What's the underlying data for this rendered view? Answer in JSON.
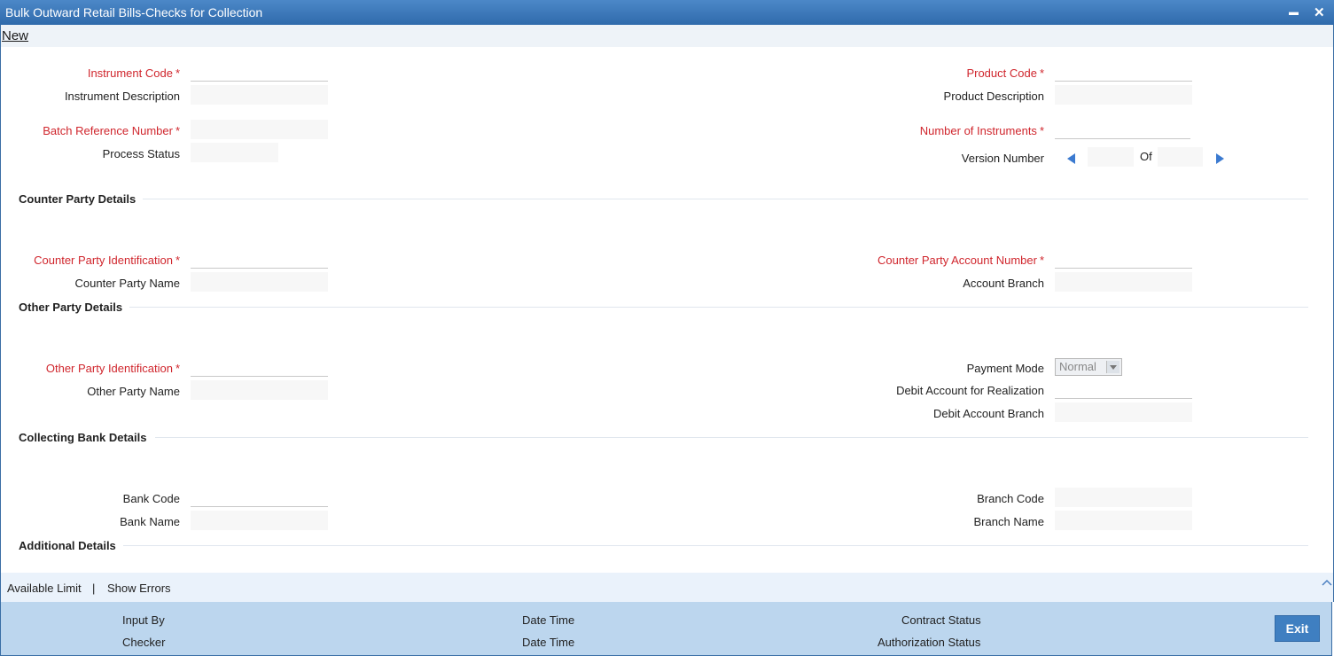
{
  "window": {
    "title": "Bulk Outward Retail Bills-Checks for Collection",
    "minimize": "▬",
    "close": "✕"
  },
  "menu": {
    "new": "New"
  },
  "main": {
    "instrument_code": "Instrument Code",
    "instrument_description": "Instrument Description",
    "batch_reference_number": "Batch Reference Number",
    "process_status": "Process Status",
    "product_code": "Product Code",
    "product_description": "Product Description",
    "number_of_instruments": "Number of Instruments",
    "version_number": "Version Number",
    "of": "Of",
    "required_marker": "*"
  },
  "counter_party": {
    "heading": "Counter Party Details",
    "identification": "Counter Party Identification",
    "name": "Counter Party Name",
    "account_number": "Counter Party Account Number",
    "account_branch": "Account Branch"
  },
  "other_party": {
    "heading": "Other Party Details",
    "identification": "Other Party Identification",
    "name": "Other Party Name",
    "payment_mode": "Payment Mode",
    "payment_mode_value": "Normal",
    "debit_account": "Debit Account for Realization",
    "debit_account_branch": "Debit Account Branch"
  },
  "collecting_bank": {
    "heading": "Collecting Bank Details",
    "bank_code": "Bank Code",
    "bank_name": "Bank Name",
    "branch_code": "Branch Code",
    "branch_name": "Branch Name"
  },
  "additional": {
    "heading": "Additional Details"
  },
  "links": {
    "available_limit": "Available Limit",
    "separator": "|",
    "show_errors": "Show Errors"
  },
  "footer": {
    "input_by": "Input By",
    "checker": "Checker",
    "date_time_1": "Date Time",
    "date_time_2": "Date Time",
    "contract_status": "Contract Status",
    "authorization_status": "Authorization Status",
    "exit": "Exit"
  },
  "colors": {
    "titlebar": "#2f6aab",
    "required": "#d0262d",
    "footer": "#bcd6ee",
    "exit_button": "#3f7fc1"
  },
  "icons": {
    "version_prev": "triangle-left",
    "version_next": "triangle-right",
    "scroll_up": "chevron-up"
  }
}
